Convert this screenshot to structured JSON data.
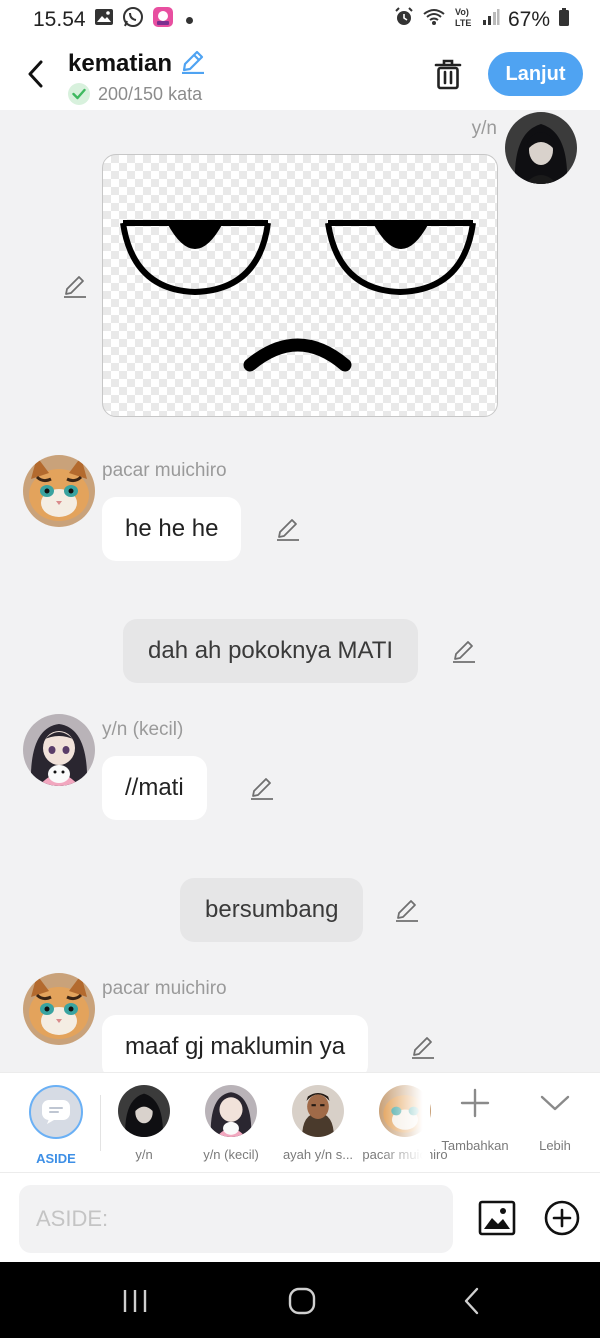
{
  "status": {
    "time": "15.54",
    "battery": "67%"
  },
  "header": {
    "title": "kematian",
    "word_count": "200/150 kata",
    "next_label": "Lanjut"
  },
  "messages": [
    {
      "type": "image",
      "speaker": "y/n",
      "side": "right",
      "image_desc": "rolled-eyes face sticker"
    },
    {
      "type": "chat",
      "speaker": "pacar muichiro",
      "text": "he he he"
    },
    {
      "type": "narration",
      "text": "dah ah pokoknya MATI"
    },
    {
      "type": "chat",
      "speaker": "y/n (kecil)",
      "text": "//mati"
    },
    {
      "type": "narration",
      "text": "bersumbang"
    },
    {
      "type": "chat",
      "speaker": "pacar muichiro",
      "text": "maaf gj maklumin ya"
    }
  ],
  "characters": [
    {
      "label": "ASIDE",
      "selected": true
    },
    {
      "label": "y/n"
    },
    {
      "label": "y/n (kecil)"
    },
    {
      "label": "ayah y/n s..."
    },
    {
      "label": "pacar muichiro"
    }
  ],
  "actions": {
    "add_label": "Tambahkan",
    "more_label": "Lebih"
  },
  "input": {
    "placeholder": "ASIDE:"
  },
  "colors": {
    "accent": "#4fa3f2",
    "selected_label": "#3d8fe6",
    "chat_bg": "#f2f2f3",
    "narration_bg": "#e6e6e7"
  }
}
